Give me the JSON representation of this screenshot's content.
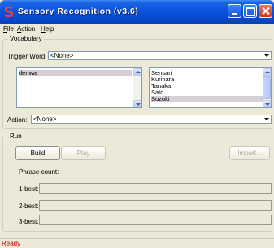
{
  "window": {
    "title": "Sensory Recognition (v3.6)"
  },
  "menu": {
    "file": "File",
    "action": "Action",
    "help": "Help"
  },
  "vocabulary": {
    "group_label": "Vocabulary",
    "trigger_label": "Trigger Word:",
    "trigger_value": "<None>",
    "left_list": [
      "denwa"
    ],
    "right_list": [
      "Sensari",
      "Kurihara",
      "Tanaka",
      "Sato",
      "Suzuki"
    ],
    "right_selected": "Suzuki",
    "action_label": "Action:",
    "action_value": "<None>"
  },
  "run": {
    "group_label": "Run",
    "build": "Build",
    "play": "Play",
    "import": "Import...",
    "phrase_count_label": "Phrase count:",
    "best": [
      "1-best:",
      "2-best:",
      "3-best:"
    ]
  },
  "status": {
    "text": "Ready"
  },
  "colors": {
    "titlebar": "#0a52dc",
    "status_text": "#c00000",
    "selection": "#d6cfd6",
    "window_bg": "#ece9d8"
  }
}
